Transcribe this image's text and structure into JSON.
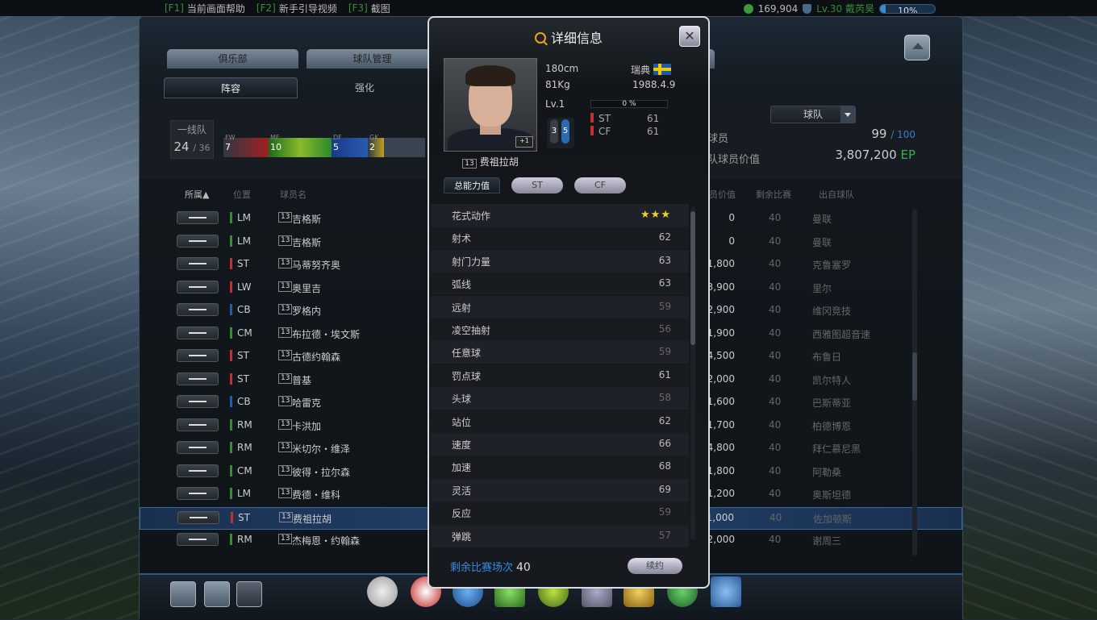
{
  "topbar": {
    "hotkeys": [
      {
        "key": "[F1]",
        "label": "当前画面帮助"
      },
      {
        "key": "[F2]",
        "label": "新手引导视频"
      },
      {
        "key": "[F3]",
        "label": "截图"
      }
    ],
    "coins": "169,904",
    "level": "Lv.30 戴芮昊",
    "progress": "10%",
    "progress_value": 0.1
  },
  "tabs_top": [
    "俱乐部",
    "球队管理"
  ],
  "tabs_sub": [
    "阵容",
    "强化"
  ],
  "squad": {
    "lineup_label": "一线队",
    "count": "24",
    "max": "/ 36",
    "positions": [
      {
        "label": "FW",
        "count": "7"
      },
      {
        "label": "MF",
        "count": "10"
      },
      {
        "label": "DF",
        "count": "5"
      },
      {
        "label": "GK",
        "count": "2"
      }
    ],
    "filter": "球队",
    "players_label": "球员",
    "players_count": "99",
    "players_max": "/ 100",
    "value_label": "队球员价值",
    "value": "3,807,200",
    "value_unit": "EP"
  },
  "table": {
    "headers": [
      "所属▲",
      "位置",
      "球员名",
      "员价值",
      "剩余比赛",
      "出自球队"
    ],
    "rows": [
      {
        "pos": "LM",
        "color": "#3a8a3a",
        "num": "13",
        "name": "吉格斯",
        "val": "0",
        "rem": "40",
        "club": "曼联"
      },
      {
        "pos": "LM",
        "color": "#3a8a3a",
        "num": "13",
        "name": "吉格斯",
        "val": "0",
        "rem": "40",
        "club": "曼联"
      },
      {
        "pos": "ST",
        "color": "#c03030",
        "num": "13",
        "name": "马蒂努齐奥",
        "val": "1,800",
        "rem": "40",
        "club": "克鲁塞罗"
      },
      {
        "pos": "LW",
        "color": "#c03030",
        "num": "13",
        "name": "奥里吉",
        "val": "3,900",
        "rem": "40",
        "club": "里尔"
      },
      {
        "pos": "CB",
        "color": "#2a5ab0",
        "num": "13",
        "name": "罗格内",
        "val": "2,900",
        "rem": "40",
        "club": "维冈竞技"
      },
      {
        "pos": "CM",
        "color": "#3a8a3a",
        "num": "13",
        "name": "布拉德・埃文斯",
        "val": "1,900",
        "rem": "40",
        "club": "西雅图超音速"
      },
      {
        "pos": "ST",
        "color": "#c03030",
        "num": "13",
        "name": "古德约翰森",
        "val": "4,500",
        "rem": "40",
        "club": "布鲁日"
      },
      {
        "pos": "ST",
        "color": "#c03030",
        "num": "13",
        "name": "普基",
        "val": "2,000",
        "rem": "40",
        "club": "凯尔特人"
      },
      {
        "pos": "CB",
        "color": "#2a5ab0",
        "num": "13",
        "name": "哈雷克",
        "val": "1,600",
        "rem": "40",
        "club": "巴斯蒂亚"
      },
      {
        "pos": "RM",
        "color": "#3a8a3a",
        "num": "13",
        "name": "卡洪加",
        "val": "1,700",
        "rem": "40",
        "club": "柏德博恩"
      },
      {
        "pos": "RM",
        "color": "#3a8a3a",
        "num": "13",
        "name": "米切尔・维泽",
        "val": "4,800",
        "rem": "40",
        "club": "拜仁慕尼黑"
      },
      {
        "pos": "CM",
        "color": "#3a8a3a",
        "num": "13",
        "name": "彼得・拉尔森",
        "val": "1,800",
        "rem": "40",
        "club": "阿勒桑"
      },
      {
        "pos": "LM",
        "color": "#3a8a3a",
        "num": "13",
        "name": "费德・维科",
        "val": "1,200",
        "rem": "40",
        "club": "奥斯坦德"
      },
      {
        "pos": "ST",
        "color": "#c03030",
        "num": "13",
        "name": "费祖拉胡",
        "val": "1,000",
        "rem": "40",
        "club": "佐加顿斯"
      },
      {
        "pos": "RM",
        "color": "#3a8a3a",
        "num": "13",
        "name": "杰梅恩・约翰森",
        "val": "2,000",
        "rem": "40",
        "club": "谢周三"
      }
    ]
  },
  "modal": {
    "title": "详细信息",
    "height": "180cm",
    "weight": "81Kg",
    "nation": "瑞典",
    "birth": "1988.4.9",
    "level": "Lv.1",
    "level_pct": "0 %",
    "badge": "+1",
    "foot_left": "3",
    "foot_right": "5",
    "num": "13",
    "name": "费祖拉胡",
    "positions": [
      {
        "pos": "ST",
        "val": "61"
      },
      {
        "pos": "CF",
        "val": "61"
      }
    ],
    "stat_tabs": [
      "总能力值",
      "ST",
      "CF"
    ],
    "skill_name": "花式动作",
    "skill_stars": "★★★",
    "stats": [
      {
        "name": "射术",
        "val": "62",
        "bright": true
      },
      {
        "name": "射门力量",
        "val": "63",
        "bright": true
      },
      {
        "name": "弧线",
        "val": "63",
        "bright": true
      },
      {
        "name": "远射",
        "val": "59",
        "bright": false
      },
      {
        "name": "凌空抽射",
        "val": "56",
        "bright": false
      },
      {
        "name": "任意球",
        "val": "59",
        "bright": false
      },
      {
        "name": "罚点球",
        "val": "61",
        "bright": true
      },
      {
        "name": "头球",
        "val": "58",
        "bright": false
      },
      {
        "name": "站位",
        "val": "62",
        "bright": true
      },
      {
        "name": "速度",
        "val": "66",
        "bright": true
      },
      {
        "name": "加速",
        "val": "68",
        "bright": true
      },
      {
        "name": "灵活",
        "val": "69",
        "bright": true
      },
      {
        "name": "反应",
        "val": "59",
        "bright": false
      },
      {
        "name": "弹跳",
        "val": "57",
        "bright": false
      }
    ],
    "remaining_label": "剩余比赛场次",
    "remaining": "40",
    "renew": "续约"
  }
}
